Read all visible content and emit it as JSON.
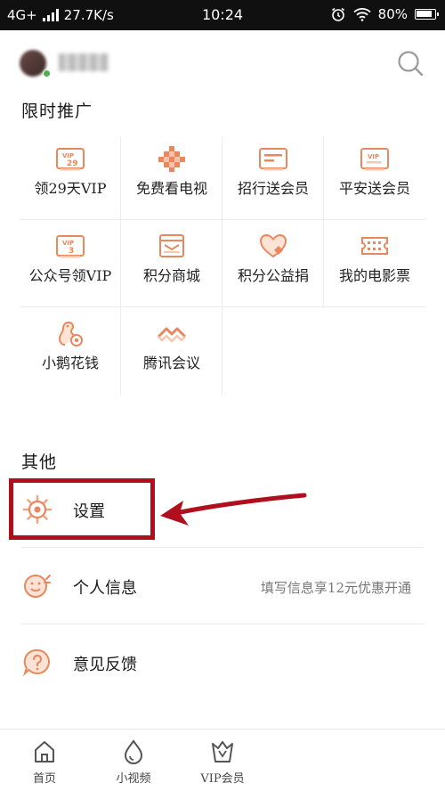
{
  "status_bar": {
    "network": "4G+",
    "speed": "27.7K/s",
    "time": "10:24",
    "battery": "80%"
  },
  "header": {
    "search_icon": "search-icon"
  },
  "promo": {
    "title": "限时推广",
    "items": [
      {
        "label": "领29天VIP",
        "icon": "vip-29-card-icon"
      },
      {
        "label": "免费看电视",
        "icon": "tv-diamond-icon"
      },
      {
        "label": "招行送会员",
        "icon": "bank-card-icon"
      },
      {
        "label": "平安送会员",
        "icon": "vip-card-icon"
      },
      {
        "label": "公众号领VIP",
        "icon": "vip-3-card-icon"
      },
      {
        "label": "积分商城",
        "icon": "shop-icon"
      },
      {
        "label": "积分公益捐",
        "icon": "heart-icon"
      },
      {
        "label": "我的电影票",
        "icon": "ticket-icon"
      },
      {
        "label": "小鹅花钱",
        "icon": "goose-icon"
      },
      {
        "label": "腾讯会议",
        "icon": "meeting-icon"
      }
    ]
  },
  "other": {
    "title": "其他",
    "items": [
      {
        "label": "设置",
        "icon": "gear-icon",
        "hint": ""
      },
      {
        "label": "个人信息",
        "icon": "profile-face-icon",
        "hint": "填写信息享12元优惠开通"
      },
      {
        "label": "意见反馈",
        "icon": "question-icon",
        "hint": ""
      }
    ]
  },
  "tabbar": {
    "tabs": [
      {
        "label": "首页",
        "icon": "home-icon"
      },
      {
        "label": "小视频",
        "icon": "drop-icon"
      },
      {
        "label": "VIP会员",
        "icon": "vip-crown-icon"
      }
    ]
  },
  "colors": {
    "accent": "#e8885e",
    "highlight": "#b0101e"
  }
}
